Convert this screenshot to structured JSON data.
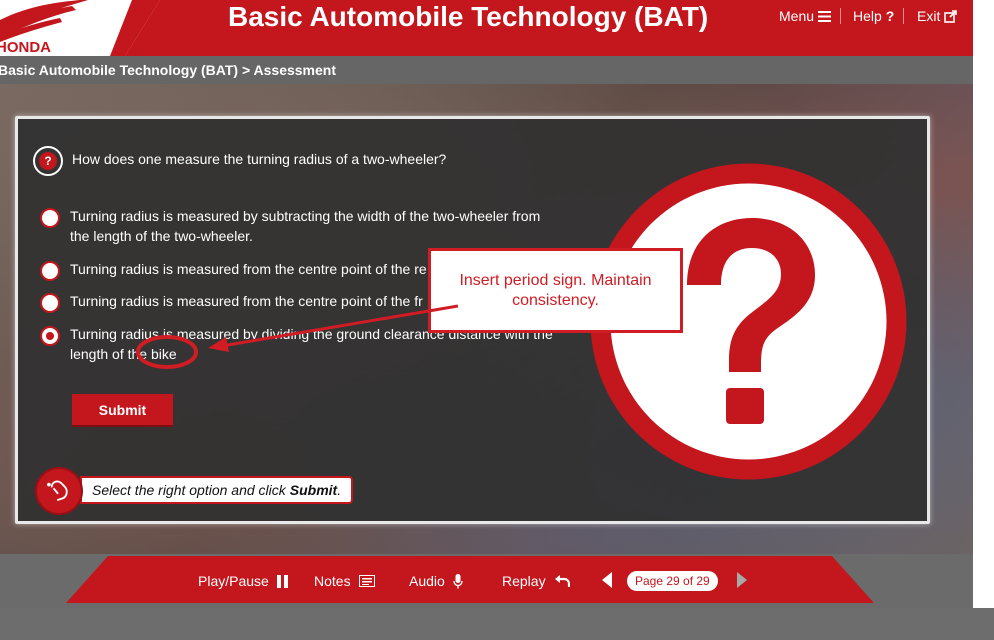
{
  "header": {
    "brand": "HONDA",
    "title": "Basic Automobile Technology (BAT)",
    "menu_label": "Menu",
    "help_label": "Help",
    "exit_label": "Exit"
  },
  "breadcrumb": "Basic Automobile Technology (BAT) > Assessment",
  "question": {
    "text": "How does one measure the turning radius of a two-wheeler?",
    "options": [
      {
        "text": "Turning radius is measured by subtracting the width of the two-wheeler from the length of the two-wheeler.",
        "selected": false
      },
      {
        "text": "Turning radius is measured from the centre point of the re",
        "selected": false
      },
      {
        "text": "Turning radius is measured from the centre point of the fr",
        "selected": false
      },
      {
        "text": "Turning radius is measured by dividing the ground clearance distance with the length of the bike",
        "selected": true
      }
    ],
    "submit_label": "Submit"
  },
  "instruction": {
    "prefix": "Select the right option and click",
    "emphasis": "Submit",
    "suffix": "."
  },
  "callout": {
    "text": "Insert period sign. Maintain consistency."
  },
  "footer": {
    "play_pause": "Play/Pause",
    "notes": "Notes",
    "audio": "Audio",
    "replay": "Replay",
    "page_indicator": "Page 29 of 29"
  },
  "colors": {
    "brand_red": "#c3161d",
    "annotation_red": "#d01c23",
    "panel_bg": "#303030"
  },
  "icons": [
    "menu-icon",
    "help-icon",
    "exit-icon",
    "question-icon",
    "mouse-click-icon",
    "big-question-mark-icon",
    "pause-icon",
    "notes-icon",
    "microphone-icon",
    "replay-icon",
    "prev-arrow-icon",
    "next-arrow-icon"
  ]
}
